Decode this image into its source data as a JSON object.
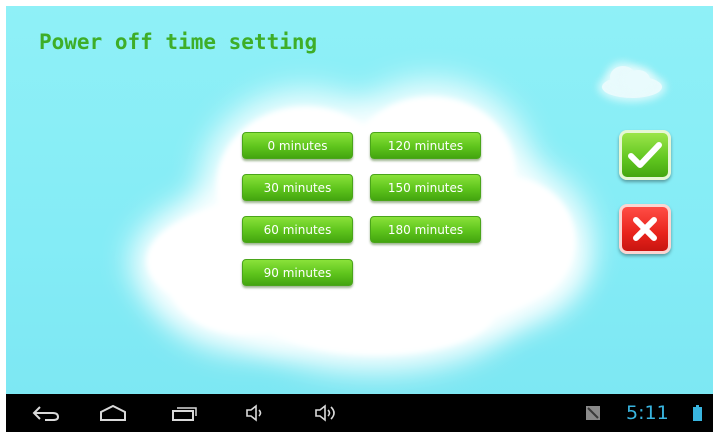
{
  "screen": {
    "title": "Power off time setting"
  },
  "options": [
    {
      "label": "0 minutes"
    },
    {
      "label": "120 minutes"
    },
    {
      "label": "30 minutes"
    },
    {
      "label": "150 minutes"
    },
    {
      "label": "60 minutes"
    },
    {
      "label": "180 minutes"
    },
    {
      "label": "90 minutes"
    }
  ],
  "actions": {
    "confirm_icon": "checkmark-icon",
    "cancel_icon": "x-icon"
  },
  "navbar": {
    "icons": [
      "back-icon",
      "home-icon",
      "recent-apps-icon",
      "volume-down-icon",
      "volume-up-icon"
    ],
    "clock": "5:11",
    "status_icons": [
      "screenshot-icon",
      "battery-icon"
    ]
  },
  "colors": {
    "background": "#87eef6",
    "title": "#3eae28",
    "button_green": "#5ec41c",
    "cancel_red": "#e8231c",
    "clock": "#39b5e0"
  }
}
